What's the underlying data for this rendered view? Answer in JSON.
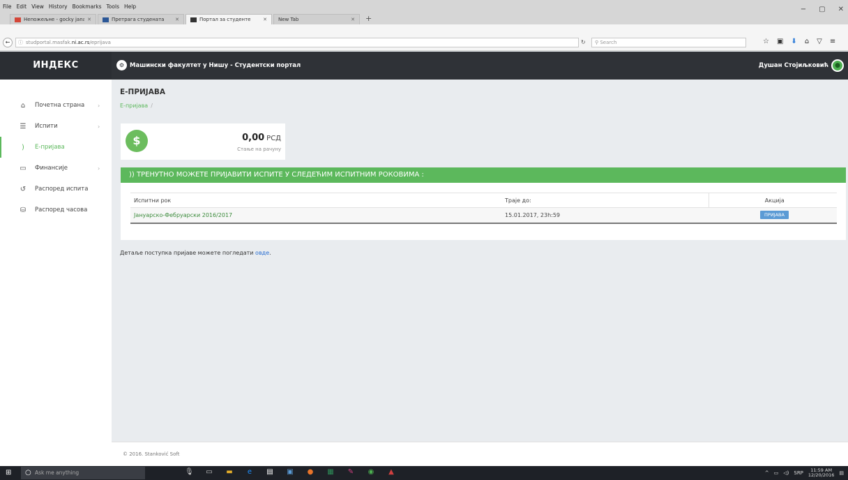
{
  "browser": {
    "menu": [
      "File",
      "Edit",
      "View",
      "History",
      "Bookmarks",
      "Tools",
      "Help"
    ],
    "window_controls": [
      "−",
      "▢",
      "✕"
    ],
    "tabs": [
      {
        "label": "Непожељне - gocky jana...",
        "color": "#d44638",
        "close": "✕"
      },
      {
        "label": "Претрага студената",
        "color": "#2b5797",
        "close": "✕"
      },
      {
        "label": "Портал за студенте",
        "color": "#333333",
        "close": "✕"
      },
      {
        "label": "New Tab",
        "color": "#cfcfcf",
        "close": "✕"
      }
    ],
    "new_tab": "+",
    "url_prefix": "studportal.masfak.",
    "url_host": "ni.ac.rs",
    "url_path": "/eprijava",
    "search_placeholder": "Search"
  },
  "app": {
    "brand": "ИНДЕКС",
    "title": "Машински факултет у Нишу - Студентски портал",
    "user_name": "Душан Стојиљковић"
  },
  "sidebar": {
    "items": [
      {
        "label": "Почетна страна",
        "icon": "home-icon",
        "glyph": "⌂",
        "chev": "›"
      },
      {
        "label": "Испити",
        "icon": "list-icon",
        "glyph": "☰",
        "chev": "›"
      },
      {
        "label": "Е-пријава",
        "icon": "feed-icon",
        "glyph": "⌂",
        "chev": ""
      },
      {
        "label": "Финансије",
        "icon": "folder-icon",
        "glyph": "▭",
        "chev": "›"
      },
      {
        "label": "Распоред испита",
        "icon": "history-icon",
        "glyph": "↺",
        "chev": ""
      },
      {
        "label": "Распоред часова",
        "icon": "database-icon",
        "glyph": "⛁",
        "chev": ""
      }
    ]
  },
  "main": {
    "page_title": "Е-ПРИЈАВА",
    "breadcrumb": "Е-пријава",
    "breadcrumb_sep": "/",
    "balance_amount": "0,00",
    "balance_currency": "РСД",
    "balance_label": "Стање на рачуну",
    "panel_heading": "ТРЕНУТНО МОЖЕТЕ ПРИЈАВИТИ ИСПИТЕ У СЛЕДЕЋИМ ИСПИТНИМ РОКОВИМА :",
    "table": {
      "headers": [
        "Испитни рок",
        "Траје до:",
        "Акција"
      ],
      "rows": [
        {
          "rok": "Јануарско-Фебруарски 2016/2017",
          "deadline": "15.01.2017, 23h:59",
          "action": "ПРИЈАВА"
        }
      ]
    },
    "details_text": "Детаље поступка пријаве можете погледати ",
    "details_link": "овде",
    "details_end": ".",
    "footer": "© 2016. Stanković Soft"
  },
  "taskbar": {
    "search_placeholder": "Ask me anything",
    "lang": "SRP",
    "time": "11:59 AM",
    "date": "12/20/2016"
  },
  "colors": {
    "accent_green": "#5cb85c",
    "header_dark": "#2f3237",
    "button_blue": "#5b9bd5"
  }
}
